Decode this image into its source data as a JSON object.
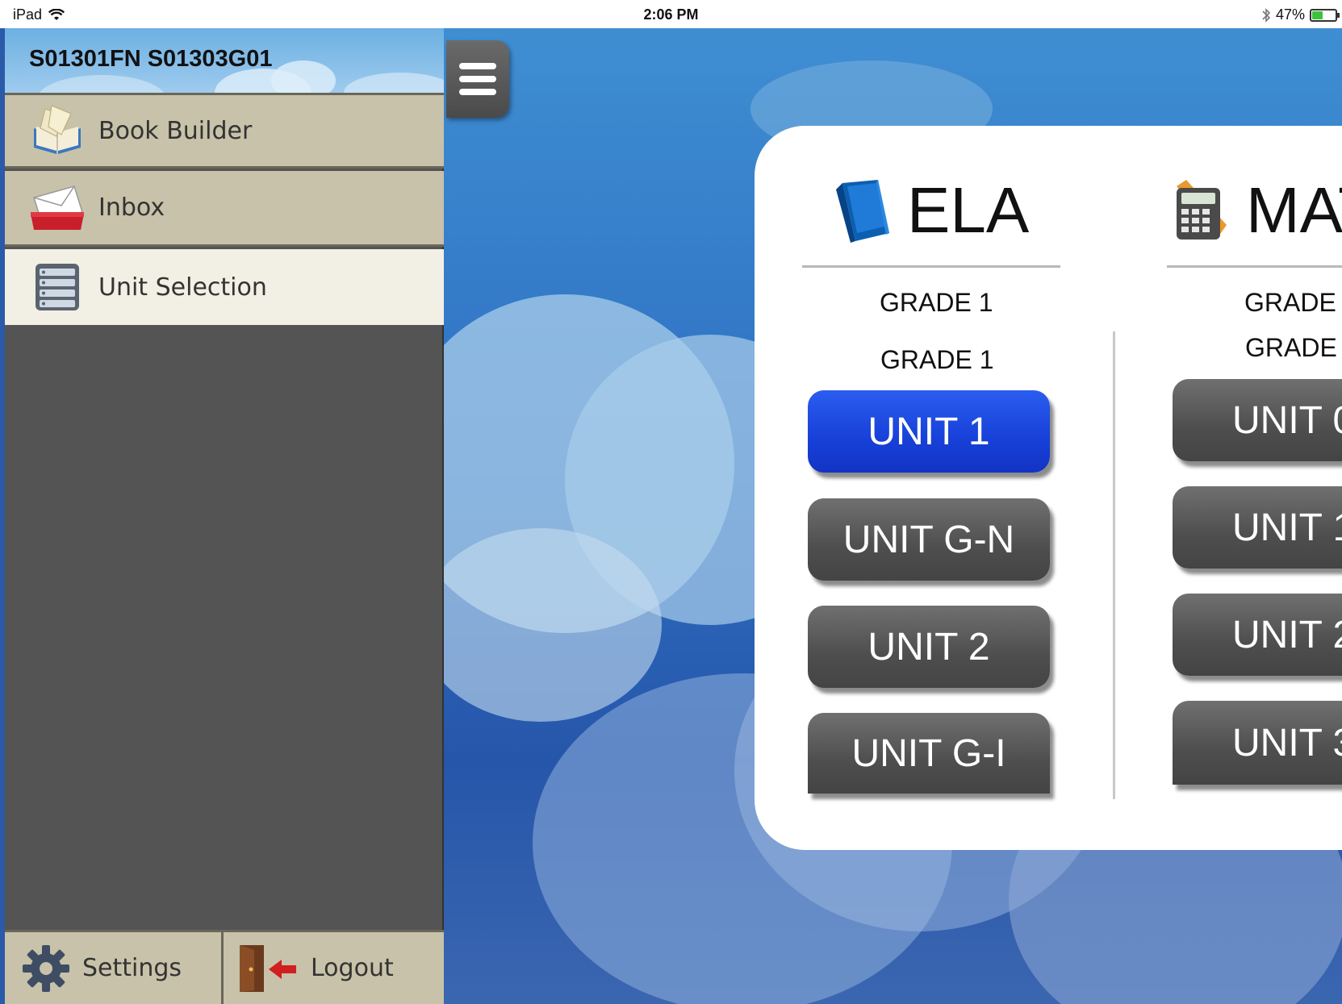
{
  "status_bar": {
    "device": "iPad",
    "time": "2:06 PM",
    "battery": "47%",
    "battery_level": 0.47
  },
  "sidebar": {
    "header_title": "S01301FN S01303G01",
    "items": [
      {
        "label": "Book Builder",
        "icon": "book-builder-icon"
      },
      {
        "label": "Inbox",
        "icon": "inbox-icon"
      },
      {
        "label": "Unit Selection",
        "icon": "unit-selection-icon"
      }
    ],
    "footer": {
      "settings_label": "Settings",
      "logout_label": "Logout"
    }
  },
  "panel": {
    "ela": {
      "title": "ELA",
      "grade_1": "GRADE 1",
      "grade_2": "GRADE 1",
      "units": [
        "UNIT 1",
        "UNIT G-N",
        "UNIT 2",
        "UNIT G-I"
      ],
      "active_unit": "UNIT 1"
    },
    "math": {
      "title": "MAT",
      "grade_1": "GRADE",
      "grade_2": "GRADE",
      "units": [
        "UNIT 0",
        "UNIT 1",
        "UNIT 2",
        "UNIT 3"
      ]
    }
  },
  "colors": {
    "active_button": "#1740d8",
    "unit_button": "#4e4e4e",
    "sidebar_bg": "#545454",
    "nav_item": "#c7c2a9",
    "nav_item_active": "#f2efe4"
  }
}
